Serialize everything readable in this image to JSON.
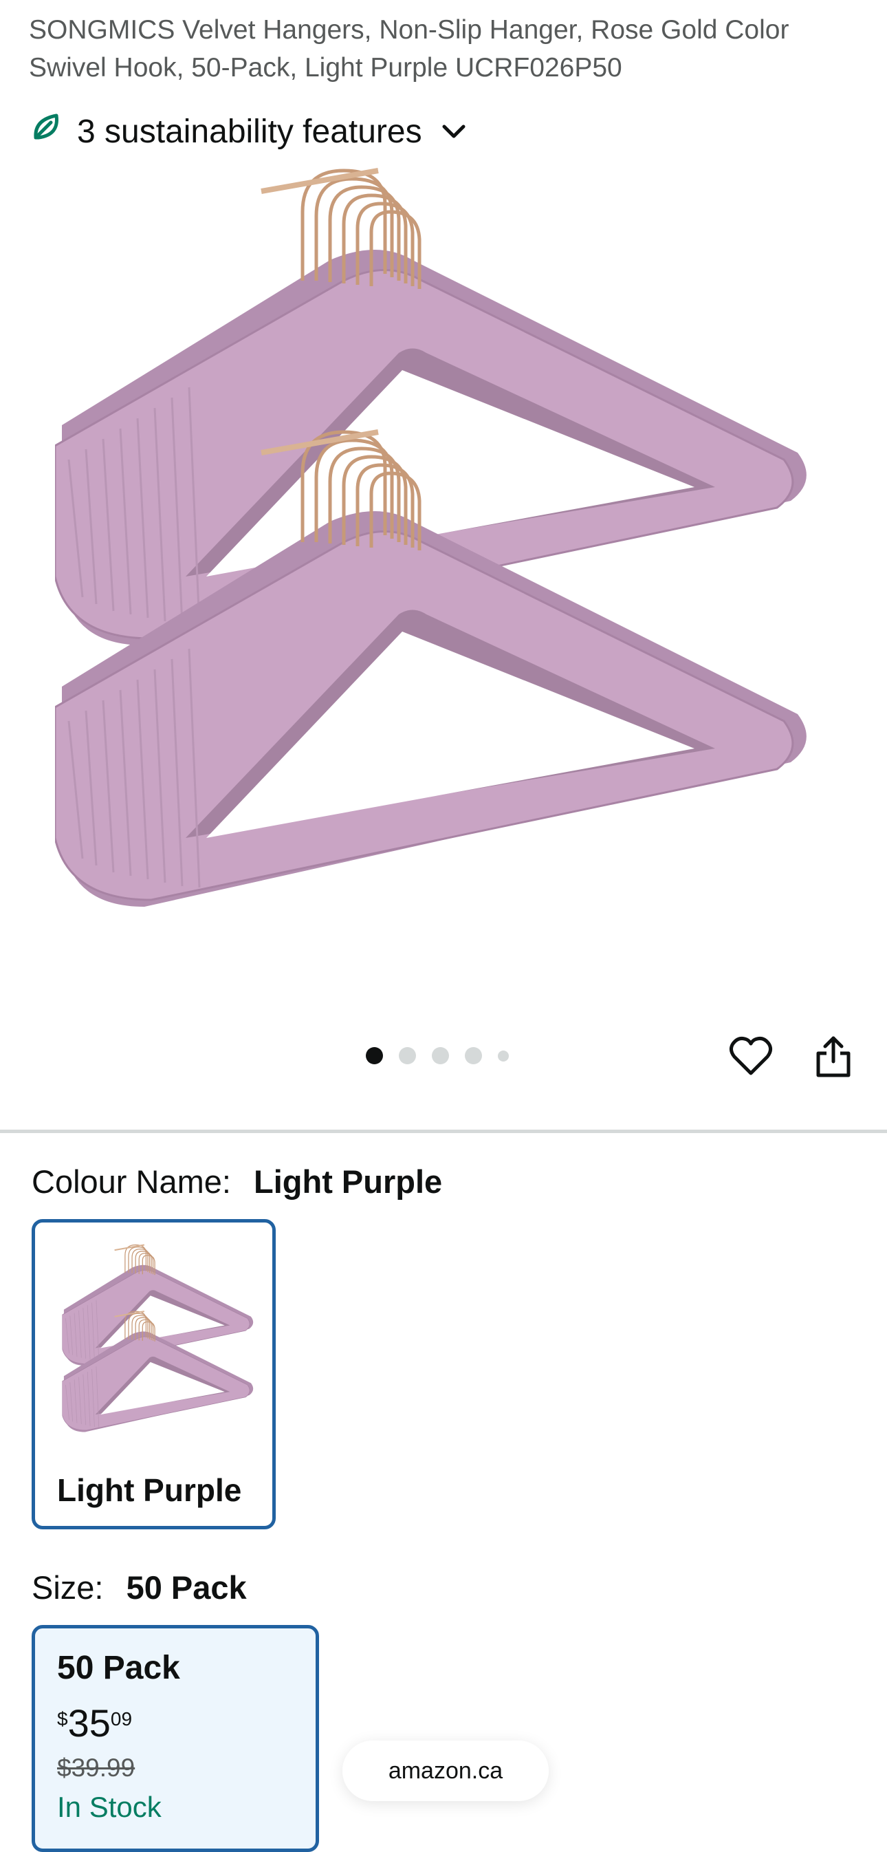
{
  "product": {
    "title": "SONGMICS Velvet Hangers, Non-Slip Hanger, Rose Gold Color Swivel Hook, 50-Pack, Light Purple UCRF026P50",
    "sustainability_text": "3 sustainability features",
    "sustainability_icon": "leaf-icon",
    "hero_image_alt": "Light purple velvet hangers with rose gold hooks",
    "carousel": {
      "total_images": 5,
      "active_index": 0
    }
  },
  "actions": {
    "wishlist_icon": "heart-icon",
    "share_icon": "share-icon"
  },
  "colour": {
    "label": "Colour Name:",
    "selected": "Light Purple",
    "options": [
      {
        "label": "Light Purple"
      }
    ]
  },
  "size": {
    "label": "Size:",
    "selected": "50 Pack",
    "options": [
      {
        "label": "50 Pack",
        "price_symbol": "$",
        "price_whole": "35",
        "price_fraction": "09",
        "was_price": "$39.99",
        "availability": "In Stock"
      }
    ]
  },
  "browser": {
    "domain": "amazon.ca"
  },
  "colors": {
    "accent_border": "#2162a1",
    "selected_bg": "#edf6fd",
    "in_stock": "#067d62",
    "leaf": "#067d62",
    "hanger_purple": "#c9a4c4",
    "hook_gold": "#c79a78"
  }
}
